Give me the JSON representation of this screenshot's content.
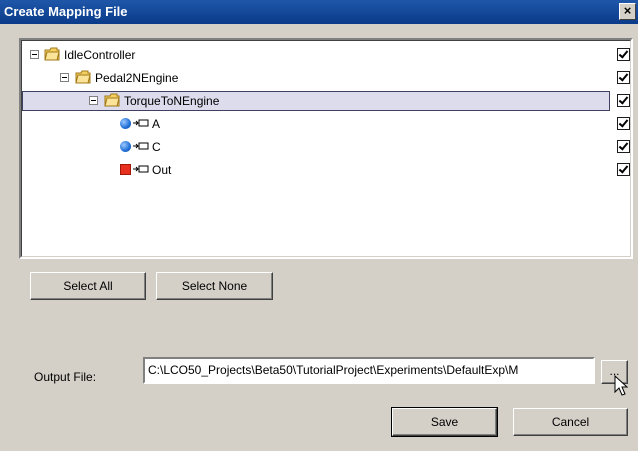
{
  "window": {
    "title": "Create Mapping File",
    "close_label": "×"
  },
  "tree": {
    "items": [
      {
        "label": "IdleController",
        "type": "folder",
        "checked": true
      },
      {
        "label": "Pedal2NEngine",
        "type": "folder",
        "checked": true
      },
      {
        "label": "TorqueToNEngine",
        "type": "folder",
        "checked": true,
        "selected": true
      },
      {
        "label": "A",
        "type": "input-port",
        "checked": true
      },
      {
        "label": "C",
        "type": "input-port",
        "checked": true
      },
      {
        "label": "Out",
        "type": "output-port",
        "checked": true
      }
    ]
  },
  "buttons": {
    "select_all": "Select All",
    "select_none": "Select None",
    "browse": "...",
    "save": "Save",
    "cancel": "Cancel"
  },
  "output": {
    "label": "Output File:",
    "value": "C:\\LCO50_Projects\\Beta50\\TutorialProject\\Experiments\\DefaultExp\\M"
  },
  "colors": {
    "titlebar": "#0a3a8a",
    "dialog_bg": "#d4d0c8",
    "selection": "#dcdcec"
  }
}
